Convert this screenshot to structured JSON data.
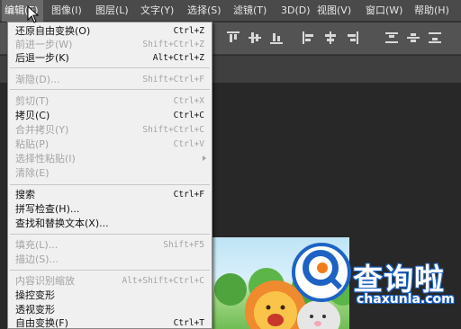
{
  "menubar": {
    "items": [
      {
        "label": "编辑(E)",
        "active": true
      },
      {
        "label": "图像(I)"
      },
      {
        "label": "图层(L)"
      },
      {
        "label": "文字(Y)"
      },
      {
        "label": "选择(S)"
      },
      {
        "label": "滤镜(T)"
      },
      {
        "label": "3D(D)"
      },
      {
        "label": "视图(V)"
      },
      {
        "label": "窗口(W)"
      },
      {
        "label": "帮助(H)"
      }
    ]
  },
  "edit_menu": {
    "items": [
      {
        "label": "还原自由变换(O)",
        "shortcut": "Ctrl+Z",
        "enabled": true
      },
      {
        "label": "前进一步(W)",
        "shortcut": "Shift+Ctrl+Z",
        "enabled": false
      },
      {
        "label": "后退一步(K)",
        "shortcut": "Alt+Ctrl+Z",
        "enabled": true
      },
      {
        "label": "渐隐(D)...",
        "shortcut": "Shift+Ctrl+F",
        "enabled": false
      },
      {
        "label": "剪切(T)",
        "shortcut": "Ctrl+X",
        "enabled": false
      },
      {
        "label": "拷贝(C)",
        "shortcut": "Ctrl+C",
        "enabled": true
      },
      {
        "label": "合并拷贝(Y)",
        "shortcut": "Shift+Ctrl+C",
        "enabled": false
      },
      {
        "label": "粘贴(P)",
        "shortcut": "Ctrl+V",
        "enabled": false
      },
      {
        "label": "选择性粘贴(I)",
        "shortcut": "",
        "enabled": false,
        "submenu": true
      },
      {
        "label": "清除(E)",
        "shortcut": "",
        "enabled": false
      },
      {
        "label": "搜索",
        "shortcut": "Ctrl+F",
        "enabled": true
      },
      {
        "label": "拼写检查(H)...",
        "shortcut": "",
        "enabled": true
      },
      {
        "label": "查找和替换文本(X)...",
        "shortcut": "",
        "enabled": true
      },
      {
        "label": "填充(L)...",
        "shortcut": "Shift+F5",
        "enabled": false
      },
      {
        "label": "描边(S)...",
        "shortcut": "",
        "enabled": false
      },
      {
        "label": "内容识别缩放",
        "shortcut": "Alt+Shift+Ctrl+C",
        "enabled": false
      },
      {
        "label": "操控变形",
        "shortcut": "",
        "enabled": true
      },
      {
        "label": "透视变形",
        "shortcut": "",
        "enabled": true
      },
      {
        "label": "自由变换(F)",
        "shortcut": "Ctrl+T",
        "enabled": true
      }
    ]
  },
  "watermark": {
    "brand": "查询啦",
    "domain": "chaxunla.com"
  },
  "colors": {
    "menubar_bg": "#4a4a4a",
    "menu_bg": "#f0f0f0",
    "disabled_text": "#a3a3a3",
    "watermark_blue": "#1e63c4",
    "watermark_orange": "#f07d1a"
  }
}
